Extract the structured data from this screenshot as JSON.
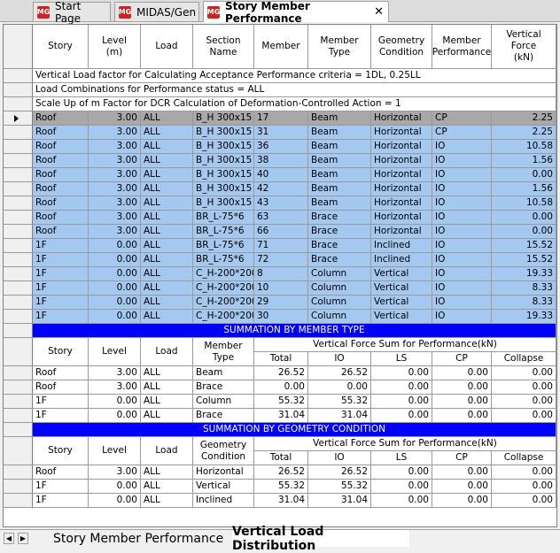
{
  "tabs": [
    {
      "label": "Start Page",
      "icon": "MG",
      "closable": false,
      "active": false
    },
    {
      "label": "MIDAS/Gen",
      "icon": "MG",
      "closable": false,
      "active": false
    },
    {
      "label": "Story Member Performance",
      "icon": "MG",
      "closable": true,
      "active": true
    }
  ],
  "close_glyph": "✕",
  "grid": {
    "headers": [
      "Story",
      "Level\n(m)",
      "Load",
      "Section\nName",
      "Member",
      "Member\nType",
      "Geometry\nCondition",
      "Member\nPerformance",
      "Vertical\nForce\n(kN)"
    ],
    "info_rows": [
      "Vertical Load factor for Calculating Acceptance Performance criteria = 1DL, 0.25LL",
      "Load Combinations for Performance status = ALL",
      " Scale Up of m Factor for DCR Calculation of Deformation-Controlled Action = 1"
    ],
    "rows": [
      [
        "Roof",
        "3.00",
        "ALL",
        "B_H 300x15",
        "17",
        "Beam",
        "Horizontal",
        "CP",
        "2.25"
      ],
      [
        "Roof",
        "3.00",
        "ALL",
        "B_H 300x15",
        "31",
        "Beam",
        "Horizontal",
        "CP",
        "2.25"
      ],
      [
        "Roof",
        "3.00",
        "ALL",
        "B_H 300x15",
        "36",
        "Beam",
        "Horizontal",
        "IO",
        "10.58"
      ],
      [
        "Roof",
        "3.00",
        "ALL",
        "B_H 300x15",
        "38",
        "Beam",
        "Horizontal",
        "IO",
        "1.56"
      ],
      [
        "Roof",
        "3.00",
        "ALL",
        "B_H 300x15",
        "40",
        "Beam",
        "Horizontal",
        "IO",
        "0.00"
      ],
      [
        "Roof",
        "3.00",
        "ALL",
        "B_H 300x15",
        "42",
        "Beam",
        "Horizontal",
        "IO",
        "1.56"
      ],
      [
        "Roof",
        "3.00",
        "ALL",
        "B_H 300x15",
        "43",
        "Beam",
        "Horizontal",
        "IO",
        "10.58"
      ],
      [
        "Roof",
        "3.00",
        "ALL",
        "BR_L-75*6",
        "63",
        "Brace",
        "Horizontal",
        "IO",
        "0.00"
      ],
      [
        "Roof",
        "3.00",
        "ALL",
        "BR_L-75*6",
        "66",
        "Brace",
        "Horizontal",
        "IO",
        "0.00"
      ],
      [
        "1F",
        "0.00",
        "ALL",
        "BR_L-75*6",
        "71",
        "Brace",
        "Inclined",
        "IO",
        "15.52"
      ],
      [
        "1F",
        "0.00",
        "ALL",
        "BR_L-75*6",
        "72",
        "Brace",
        "Inclined",
        "IO",
        "15.52"
      ],
      [
        "1F",
        "0.00",
        "ALL",
        "C_H-200*200",
        "8",
        "Column",
        "Vertical",
        "IO",
        "19.33"
      ],
      [
        "1F",
        "0.00",
        "ALL",
        "C_H-200*200",
        "10",
        "Column",
        "Vertical",
        "IO",
        "8.33"
      ],
      [
        "1F",
        "0.00",
        "ALL",
        "C_H-200*200",
        "29",
        "Column",
        "Vertical",
        "IO",
        "8.33"
      ],
      [
        "1F",
        "0.00",
        "ALL",
        "C_H-200*200",
        "30",
        "Column",
        "Vertical",
        "IO",
        "19.33"
      ]
    ],
    "selected_row": 0
  },
  "summary_type": {
    "title": "SUMMATION BY MEMBER TYPE",
    "col_story": "Story",
    "col_level": "Level",
    "col_load": "Load",
    "col_group": "Member\nType",
    "vf_header": "Vertical Force Sum for Performance(kN)",
    "sub": [
      "Total",
      "IO",
      "LS",
      "CP",
      "Collapse"
    ],
    "rows": [
      [
        "Roof",
        "3.00",
        "ALL",
        "Beam",
        "26.52",
        "26.52",
        "0.00",
        "0.00",
        "0.00"
      ],
      [
        "Roof",
        "3.00",
        "ALL",
        "Brace",
        "0.00",
        "0.00",
        "0.00",
        "0.00",
        "0.00"
      ],
      [
        "1F",
        "0.00",
        "ALL",
        "Column",
        "55.32",
        "55.32",
        "0.00",
        "0.00",
        "0.00"
      ],
      [
        "1F",
        "0.00",
        "ALL",
        "Brace",
        "31.04",
        "31.04",
        "0.00",
        "0.00",
        "0.00"
      ]
    ]
  },
  "summary_geom": {
    "title": "SUMMATION BY GEOMETRY CONDITION",
    "col_story": "Story",
    "col_level": "Level",
    "col_load": "Load",
    "col_group": "Geometry\nCondition",
    "vf_header": "Vertical Force Sum for Performance(kN)",
    "sub": [
      "Total",
      "IO",
      "LS",
      "CP",
      "Collapse"
    ],
    "rows": [
      [
        "Roof",
        "3.00",
        "ALL",
        "Horizontal",
        "26.52",
        "26.52",
        "0.00",
        "0.00",
        "0.00"
      ],
      [
        "1F",
        "0.00",
        "ALL",
        "Vertical",
        "55.32",
        "55.32",
        "0.00",
        "0.00",
        "0.00"
      ],
      [
        "1F",
        "0.00",
        "ALL",
        "Inclined",
        "31.04",
        "31.04",
        "0.00",
        "0.00",
        "0.00"
      ]
    ]
  },
  "sheet_tabs": [
    {
      "label": "Story Member Performance",
      "active": false
    },
    {
      "label": "Vertical Load Distribution",
      "active": true
    }
  ],
  "nav_buttons": [
    "◀",
    "▶"
  ],
  "colors": {
    "selected_row": "#a8a8a8",
    "data_row": "#a4c8f0",
    "banner": "#0000ff"
  }
}
